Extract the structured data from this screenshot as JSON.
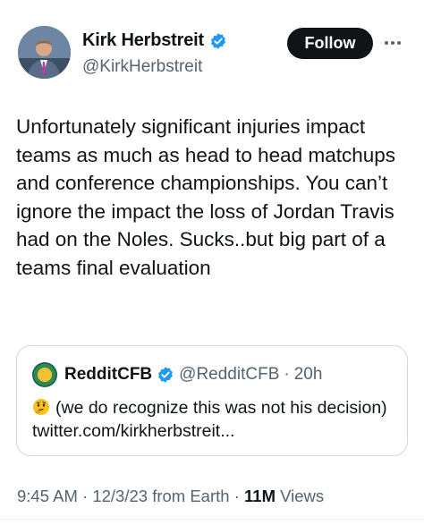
{
  "author": {
    "name": "Kirk Herbstreit",
    "handle": "@KirkHerbstreit",
    "verified_color": "#1d9bf0"
  },
  "follow_button": {
    "label": "Follow"
  },
  "more_icon": "ellipsis-icon",
  "tweet": {
    "text": "Unfortunately significant injuries impact teams as much as head to head matchups and conference championships. You can’t ignore the impact the loss of Jordan Travis had on the Noles. Sucks..but big part of a teams final evaluation"
  },
  "quoted_tweet": {
    "name": "RedditCFB",
    "handle": "@RedditCFB",
    "separator": "·",
    "time": "20h",
    "emoji": "thinking-face-emoji",
    "text": "(we do recognize this was not his decision) twitter.com/kirkherbstreit..."
  },
  "meta": {
    "time": "9:45 AM",
    "sep1": "·",
    "date": "12/3/23 from Earth",
    "sep2": "·",
    "views_count": "11M",
    "views_label": "Views"
  }
}
